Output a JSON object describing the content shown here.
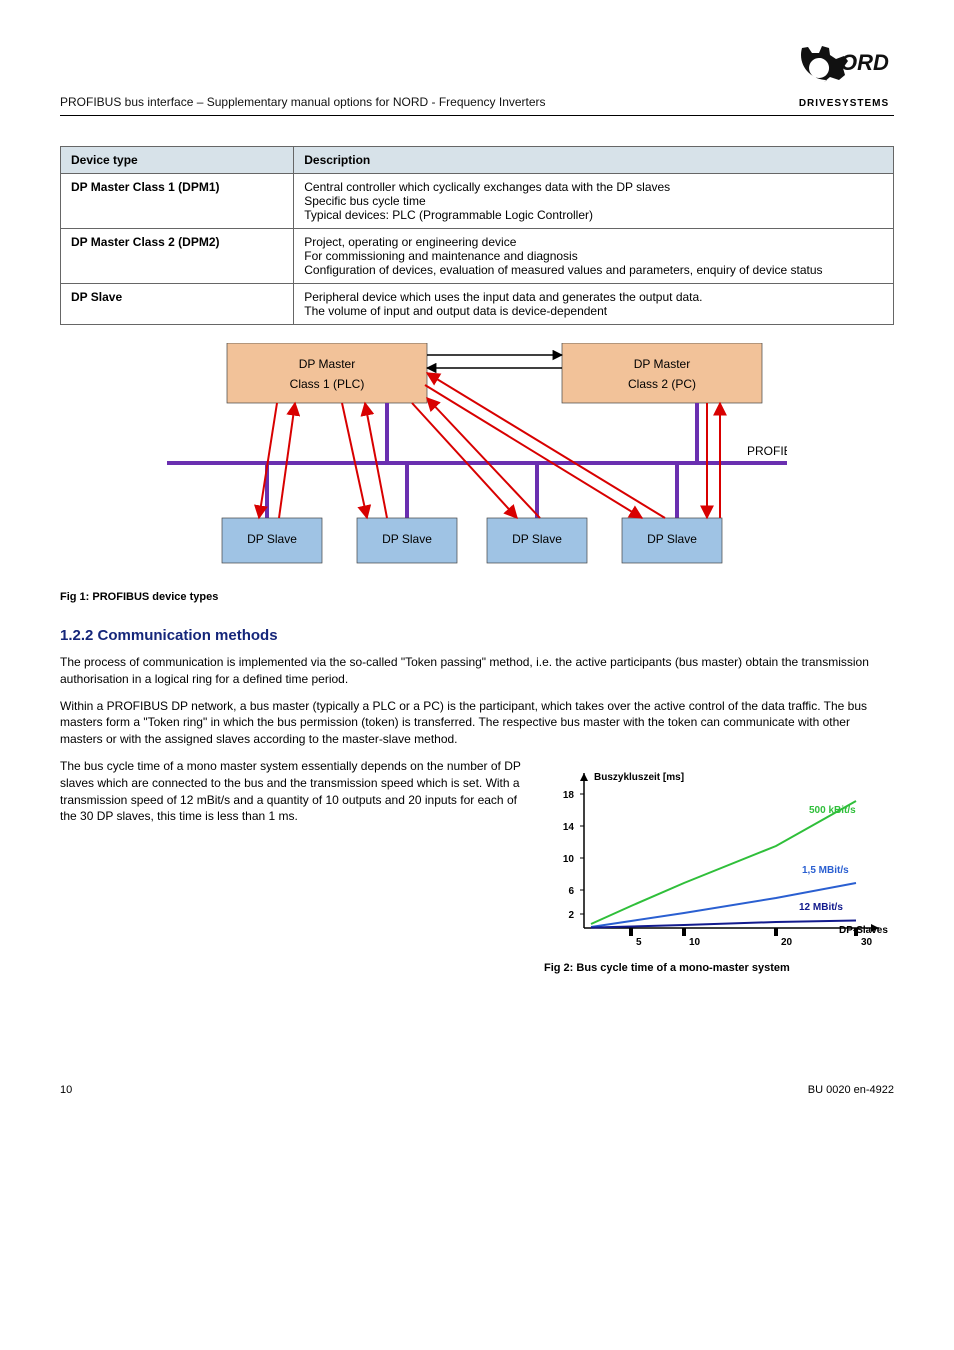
{
  "header": {
    "doc_title": "PROFIBUS bus interface – Supplementary manual options for NORD - Frequency Inverters",
    "brand_name": "NORD",
    "brand_sub": "DRIVESYSTEMS"
  },
  "table": {
    "head_type": "Device type",
    "head_desc": "Description",
    "rows": [
      {
        "label": "DP Master Class 1 (DPM1)",
        "desc1": "Central controller which cyclically exchanges data with the DP slaves",
        "desc2": "Specific bus cycle time",
        "desc3": "Typical devices: PLC (Programmable Logic Controller)"
      },
      {
        "label": "DP Master Class 2 (DPM2)",
        "desc1": "Project, operating or engineering device",
        "desc2": "For commissioning and maintenance and diagnosis",
        "desc3": "Configuration of devices, evaluation of measured values and parameters, enquiry of device status"
      },
      {
        "label": "DP Slave",
        "desc1": "Peripheral device which uses the input data and generates the output data.",
        "desc2": "The volume of input and output data is device-dependent"
      }
    ]
  },
  "diagram": {
    "master1_top": "DP Master",
    "master1_bot": "Class 1 (PLC)",
    "master2_top": "DP Master",
    "master2_bot": "Class 2 (PC)",
    "slaves": [
      "DP Slave",
      "DP Slave",
      "DP Slave",
      "DP Slave"
    ],
    "bus_label": "PROFIBUS"
  },
  "fig1": {
    "caption_no": "Fig 1:",
    "caption_txt": "PROFIBUS device types"
  },
  "section": {
    "heading": "1.2.2   Communication methods",
    "p1": "The process of communication is implemented via the so-called \"Token passing\" method, i.e. the active participants (bus master) obtain the transmission authorisation in a logical ring for a defined time period.",
    "p2": "Within a PROFIBUS DP network, a bus master (typically a PLC or a PC) is the participant, which takes over the active control of the data traffic. The bus masters form a \"Token ring\" in which the bus permission (token) is transferred. The respective bus master with the token can communicate with other masters or with the assigned slaves according to the master-slave method.",
    "p3_left": "The bus cycle time of a mono master system essentially depends on the number of DP slaves which are connected to the bus and the transmission speed which is set. With a transmission speed of 12 mBit/s and a quantity of 10 outputs and 20 inputs for each of the 30 DP slaves, this time is less than 1 ms.",
    "fig2_no": "Fig 2:",
    "fig2_txt": "Bus cycle time of a mono-master system"
  },
  "chart_data": {
    "type": "line",
    "title": "",
    "xlabel": "DP-Slaves",
    "ylabel": "Buszykluszeit [ms]",
    "ylim": [
      0,
      18
    ],
    "xlim": [
      0,
      30
    ],
    "categories": [
      1,
      5,
      10,
      20,
      30
    ],
    "xticks": [
      5,
      10,
      20,
      30
    ],
    "yticks": [
      2,
      6,
      10,
      14,
      18
    ],
    "series": [
      {
        "name": "500 kBit/s",
        "color": "#2fbf3a",
        "values": [
          0.5,
          3,
          6,
          11,
          17
        ]
      },
      {
        "name": "1,5 MBit/s",
        "color": "#2a5fd1",
        "values": [
          0.2,
          1,
          2,
          4,
          6
        ]
      },
      {
        "name": "12 MBit/s",
        "color": "#121a8d",
        "values": [
          0.05,
          0.2,
          0.4,
          0.8,
          1
        ]
      }
    ],
    "legend_labels": {
      "s500": "500 kBit/s",
      "s15": "1,5 MBit/s",
      "s12": "12 MBit/s"
    }
  },
  "footer": {
    "page": "10",
    "doc_id": "BU 0020 en-4922"
  }
}
